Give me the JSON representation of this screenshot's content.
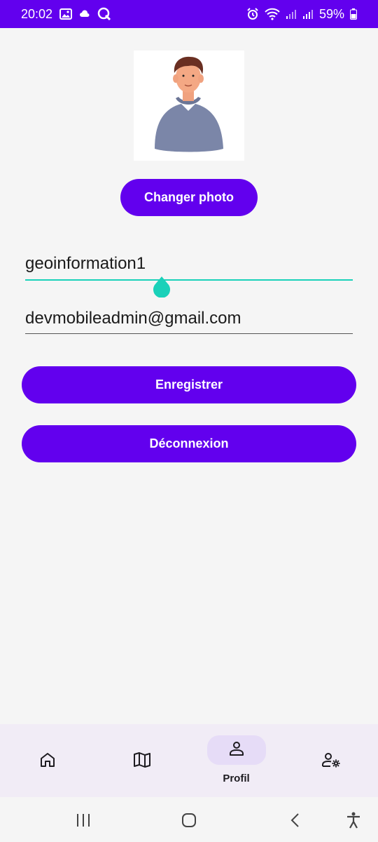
{
  "status_bar": {
    "time": "20:02",
    "battery": "59%",
    "background": "#6200ee"
  },
  "profile": {
    "change_photo_label": "Changer photo",
    "username_value": "geoinformation1",
    "email_value": "devmobileadmin@gmail.com",
    "save_label": "Enregistrer",
    "logout_label": "Déconnexion"
  },
  "bottom_nav": {
    "items": [
      {
        "icon": "home-icon",
        "label": "",
        "active": false
      },
      {
        "icon": "map-icon",
        "label": "",
        "active": false
      },
      {
        "icon": "person-icon",
        "label": "Profil",
        "active": true
      },
      {
        "icon": "user-settings-icon",
        "label": "",
        "active": false
      }
    ]
  },
  "colors": {
    "primary": "#6200ee",
    "accent": "#1ad1b9",
    "nav_background": "#f1ecf6",
    "nav_active_pill": "#e6dcf7"
  },
  "system_nav": {
    "icons": [
      "recents-icon",
      "home-button-icon",
      "back-icon",
      "accessibility-icon"
    ]
  }
}
